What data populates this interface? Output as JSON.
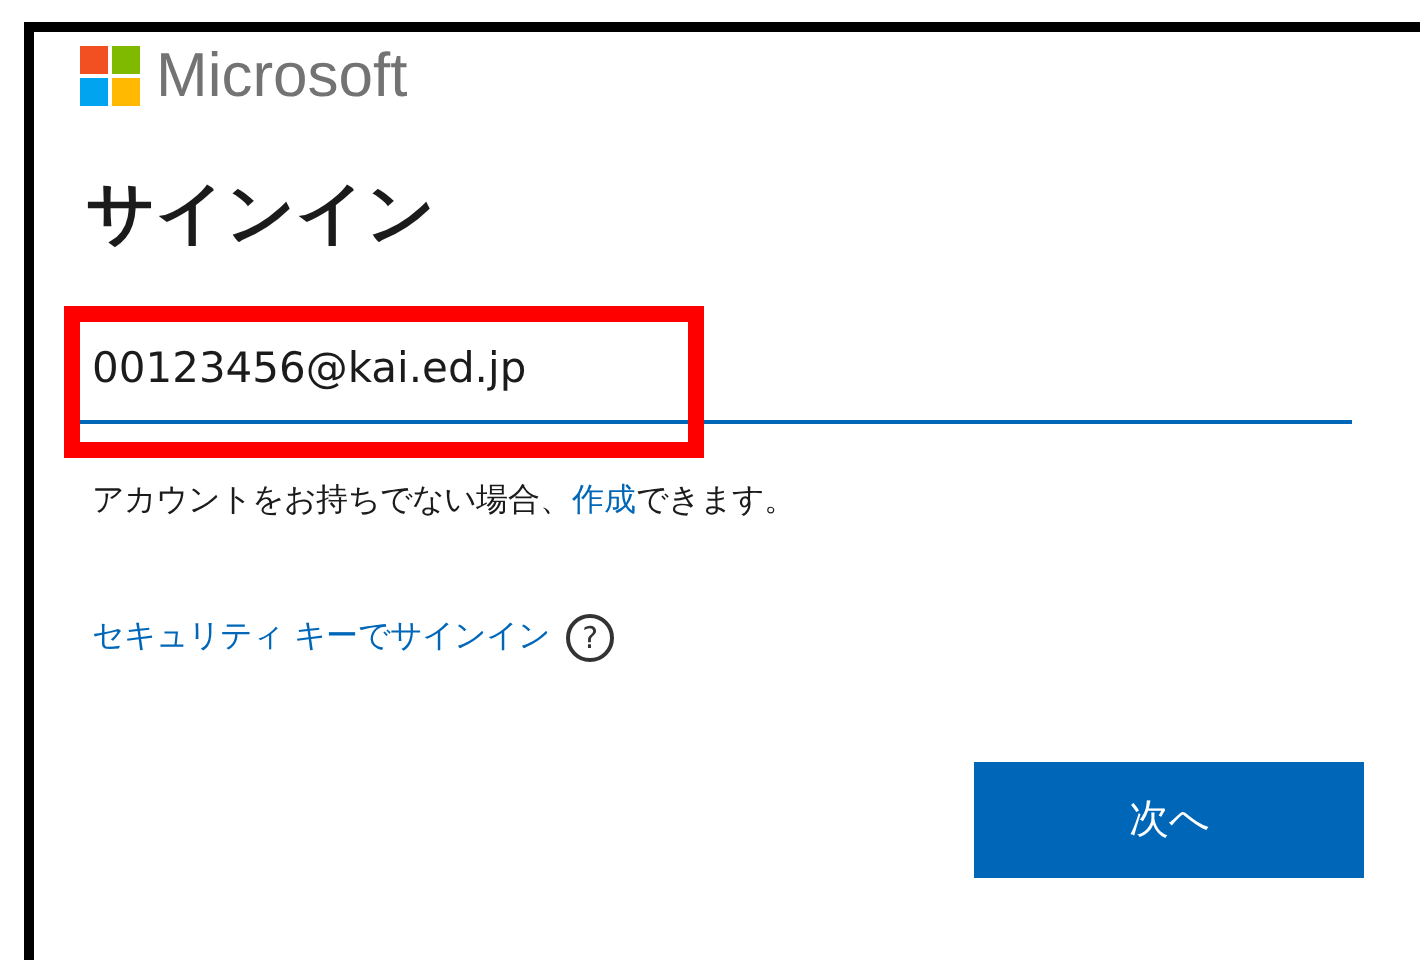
{
  "logo": {
    "text": "Microsoft"
  },
  "title": "サインイン",
  "email_field": {
    "value": "00123456@kai.ed.jp",
    "highlighted": true
  },
  "signup_text": {
    "before": "アカウントをお持ちでない場合、",
    "link": "作成",
    "after": "できます。"
  },
  "security_key_link": {
    "label": "セキュリティ キーでサインイン",
    "help_icon": "?"
  },
  "buttons": [
    {
      "label": "次へ",
      "kind": "primary"
    }
  ]
}
